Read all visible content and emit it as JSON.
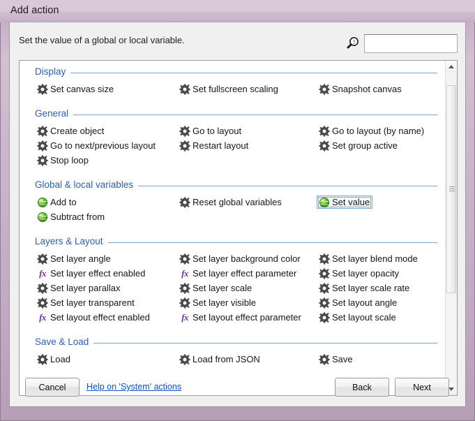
{
  "window": {
    "title": "Add action"
  },
  "header": {
    "instruction": "Set the value of a global or local variable.",
    "search_icon": "search-help-icon",
    "search_value": "",
    "search_placeholder": ""
  },
  "colors": {
    "section_header_text": "#2b5fb0",
    "section_rule": "#7ba3d8",
    "selection_fill": "#f4fbff",
    "selection_border": "#7aa9d4",
    "link": "#0a50c8",
    "fx_icon": "#6b2fa8",
    "globe_icon": "#4faa28",
    "gear_icon": "#4a4a4a",
    "titlebar": "#d3c0d3"
  },
  "list": {
    "selected_action": "Set value",
    "sections": [
      {
        "title": "Display",
        "items": [
          {
            "label": "Set canvas size",
            "icon": "gear-icon",
            "column": 0,
            "row": 0,
            "selected": false
          },
          {
            "label": "Set fullscreen scaling",
            "icon": "gear-icon",
            "column": 1,
            "row": 0,
            "selected": false
          },
          {
            "label": "Snapshot canvas",
            "icon": "gear-icon",
            "column": 2,
            "row": 0,
            "selected": false
          }
        ]
      },
      {
        "title": "General",
        "items": [
          {
            "label": "Create object",
            "icon": "gear-icon",
            "column": 0,
            "row": 0,
            "selected": false
          },
          {
            "label": "Go to layout",
            "icon": "gear-icon",
            "column": 1,
            "row": 0,
            "selected": false
          },
          {
            "label": "Go to layout (by name)",
            "icon": "gear-icon",
            "column": 2,
            "row": 0,
            "selected": false
          },
          {
            "label": "Go to next/previous layout",
            "icon": "gear-icon",
            "column": 0,
            "row": 1,
            "selected": false
          },
          {
            "label": "Restart layout",
            "icon": "gear-icon",
            "column": 1,
            "row": 1,
            "selected": false
          },
          {
            "label": "Set group active",
            "icon": "gear-icon",
            "column": 2,
            "row": 1,
            "selected": false
          },
          {
            "label": "Stop loop",
            "icon": "gear-icon",
            "column": 0,
            "row": 2,
            "selected": false
          }
        ]
      },
      {
        "title": "Global & local variables",
        "items": [
          {
            "label": "Add to",
            "icon": "globe-icon",
            "column": 0,
            "row": 0,
            "selected": false
          },
          {
            "label": "Reset global variables",
            "icon": "gear-icon",
            "column": 1,
            "row": 0,
            "selected": false
          },
          {
            "label": "Set value",
            "icon": "globe-icon",
            "column": 2,
            "row": 0,
            "selected": true
          },
          {
            "label": "Subtract from",
            "icon": "globe-icon",
            "column": 0,
            "row": 1,
            "selected": false
          }
        ]
      },
      {
        "title": "Layers & Layout",
        "items": [
          {
            "label": "Set layer angle",
            "icon": "gear-icon",
            "column": 0,
            "row": 0,
            "selected": false
          },
          {
            "label": "Set layer background color",
            "icon": "gear-icon",
            "column": 1,
            "row": 0,
            "selected": false
          },
          {
            "label": "Set layer blend mode",
            "icon": "gear-icon",
            "column": 2,
            "row": 0,
            "selected": false
          },
          {
            "label": "Set layer effect enabled",
            "icon": "fx-icon",
            "column": 0,
            "row": 1,
            "selected": false
          },
          {
            "label": "Set layer effect parameter",
            "icon": "fx-icon",
            "column": 1,
            "row": 1,
            "selected": false
          },
          {
            "label": "Set layer opacity",
            "icon": "gear-icon",
            "column": 2,
            "row": 1,
            "selected": false
          },
          {
            "label": "Set layer parallax",
            "icon": "gear-icon",
            "column": 0,
            "row": 2,
            "selected": false
          },
          {
            "label": "Set layer scale",
            "icon": "gear-icon",
            "column": 1,
            "row": 2,
            "selected": false
          },
          {
            "label": "Set layer scale rate",
            "icon": "gear-icon",
            "column": 2,
            "row": 2,
            "selected": false
          },
          {
            "label": "Set layer transparent",
            "icon": "gear-icon",
            "column": 0,
            "row": 3,
            "selected": false
          },
          {
            "label": "Set layer visible",
            "icon": "gear-icon",
            "column": 1,
            "row": 3,
            "selected": false
          },
          {
            "label": "Set layout angle",
            "icon": "gear-icon",
            "column": 2,
            "row": 3,
            "selected": false
          },
          {
            "label": "Set layout effect enabled",
            "icon": "fx-icon",
            "column": 0,
            "row": 4,
            "selected": false
          },
          {
            "label": "Set layout effect parameter",
            "icon": "fx-icon",
            "column": 1,
            "row": 4,
            "selected": false
          },
          {
            "label": "Set layout scale",
            "icon": "gear-icon",
            "column": 2,
            "row": 4,
            "selected": false
          }
        ]
      },
      {
        "title": "Save & Load",
        "items": [
          {
            "label": "Load",
            "icon": "gear-icon",
            "column": 0,
            "row": 0,
            "selected": false
          },
          {
            "label": "Load from JSON",
            "icon": "gear-icon",
            "column": 1,
            "row": 0,
            "selected": false
          },
          {
            "label": "Save",
            "icon": "gear-icon",
            "column": 2,
            "row": 0,
            "selected": false
          }
        ]
      }
    ]
  },
  "scrollbar": {
    "up_icon": "scroll-up-arrow-icon",
    "down_icon": "scroll-down-arrow-icon",
    "thumb_top_pct": 4,
    "thumb_height_pct": 67
  },
  "footer": {
    "cancel_label": "Cancel",
    "help_link": "Help on 'System' actions",
    "back_label": "Back",
    "next_label": "Next"
  }
}
